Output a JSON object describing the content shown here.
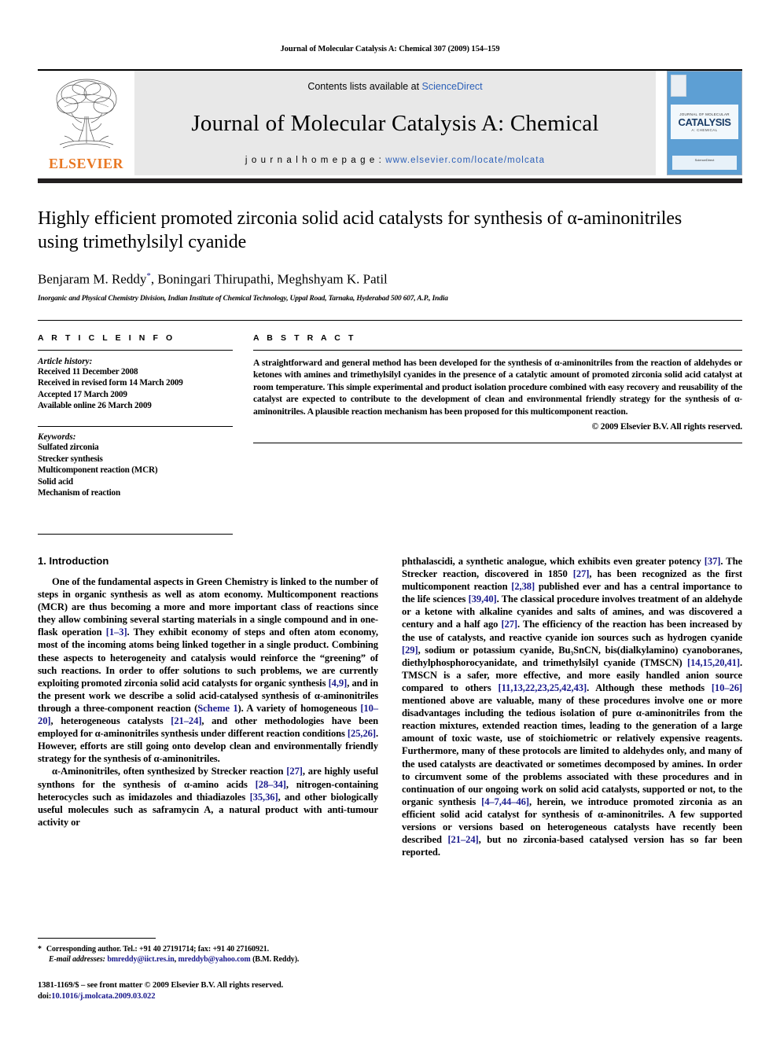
{
  "running_head": "Journal of Molecular Catalysis A: Chemical 307 (2009) 154–159",
  "masthead": {
    "publisher_name": "ELSEVIER",
    "contents_prefix": "Contents lists available at ",
    "contents_link": "ScienceDirect",
    "journal_title": "Journal of Molecular Catalysis A: Chemical",
    "homepage_label": "j o u r n a l   h o m e p a g e :  ",
    "homepage_url": "www.elsevier.com/locate/molcata",
    "cover": {
      "kicker": "JOURNAL OF MOLECULAR",
      "main": "CATALYSIS",
      "sub": "A: CHEMICAL",
      "footer": "ScienceDirect"
    }
  },
  "article": {
    "title": "Highly efficient promoted zirconia solid acid catalysts for synthesis of α-aminonitriles using trimethylsilyl cyanide",
    "authors": "Benjaram M. Reddy, Boningari Thirupathi, Meghshyam K. Patil",
    "corresponding_marker": "*",
    "authors_before_marker": "Benjaram M. Reddy",
    "authors_after_marker": ", Boningari Thirupathi, Meghshyam K. Patil",
    "affiliation": "Inorganic and Physical Chemistry Division, Indian Institute of Chemical Technology, Uppal Road, Tarnaka, Hyderabad 500 607, A.P., India"
  },
  "article_info": {
    "heading": "A R T I C L E   I N F O",
    "history_label": "Article history:",
    "history": [
      "Received 11 December 2008",
      "Received in revised form 14 March 2009",
      "Accepted 17 March 2009",
      "Available online 26 March 2009"
    ],
    "keywords_label": "Keywords:",
    "keywords": [
      "Sulfated zirconia",
      "Strecker synthesis",
      "Multicomponent reaction (MCR)",
      "Solid acid",
      "Mechanism of reaction"
    ]
  },
  "abstract": {
    "heading": "A B S T R A C T",
    "text": "A straightforward and general method has been developed for the synthesis of α-aminonitriles from the reaction of aldehydes or ketones with amines and trimethylsilyl cyanides in the presence of a catalytic amount of promoted zirconia solid acid catalyst at room temperature. This simple experimental and product isolation procedure combined with easy recovery and reusability of the catalyst are expected to contribute to the development of clean and environmental friendly strategy for the synthesis of α-aminonitriles. A plausible reaction mechanism has been proposed for this multicomponent reaction.",
    "copyright": "© 2009 Elsevier B.V. All rights reserved."
  },
  "introduction": {
    "section_number": "1.",
    "section_title": "Introduction",
    "left_paragraph_1": [
      {
        "t": "One of the fundamental aspects in Green Chemistry is linked to the number of steps in organic synthesis as well as atom economy. Multicomponent reactions (MCR) are thus becoming a more and more important class of reactions since they allow combining several starting materials in a single compound and in one-flask operation "
      },
      {
        "t": "[1–3]",
        "ref": true
      },
      {
        "t": ". They exhibit economy of steps and often atom economy, most of the incoming atoms being linked together in a single product. Combining these aspects to heterogeneity and catalysis would reinforce the “greening” of such reactions. In order to offer solutions to such problems, we are currently exploiting promoted zirconia solid acid catalysts for organic synthesis "
      },
      {
        "t": "[4,9]",
        "ref": true
      },
      {
        "t": ", and in the present work we describe a solid acid-catalysed synthesis of α-aminonitriles through a three-component reaction ("
      },
      {
        "t": "Scheme 1",
        "ref": true
      },
      {
        "t": "). A variety of homogeneous "
      },
      {
        "t": "[10–20]",
        "ref": true
      },
      {
        "t": ", heterogeneous catalysts "
      },
      {
        "t": "[21–24]",
        "ref": true
      },
      {
        "t": ", and other methodologies have been employed for α-aminonitriles synthesis under different reaction conditions "
      },
      {
        "t": "[25,26]",
        "ref": true
      },
      {
        "t": ". However, efforts are still going onto develop clean and environmentally friendly strategy for the synthesis of α-aminonitriles."
      }
    ],
    "left_paragraph_2": [
      {
        "t": "α-Aminonitriles, often synthesized by Strecker reaction "
      },
      {
        "t": "[27]",
        "ref": true
      },
      {
        "t": ", are highly useful synthons for the synthesis of α-amino acids "
      },
      {
        "t": "[28–34]",
        "ref": true
      },
      {
        "t": ", nitrogen-containing heterocycles such as imidazoles and thiadiazoles "
      },
      {
        "t": "[35,36]",
        "ref": true
      },
      {
        "t": ", and other biologically useful molecules such as saframycin A, a natural product with anti-tumour activity or"
      }
    ],
    "right_paragraph_1": [
      {
        "t": "phthalascidi, a synthetic analogue, which exhibits even greater potency "
      },
      {
        "t": "[37]",
        "ref": true
      },
      {
        "t": ". The Strecker reaction, discovered in 1850 "
      },
      {
        "t": "[27]",
        "ref": true
      },
      {
        "t": ", has been recognized as the first multicomponent reaction "
      },
      {
        "t": "[2,38]",
        "ref": true
      },
      {
        "t": " published ever and has a central importance to the life sciences "
      },
      {
        "t": "[39,40]",
        "ref": true
      },
      {
        "t": ". The classical procedure involves treatment of an aldehyde or a ketone with alkaline cyanides and salts of amines, and was discovered a century and a half ago "
      },
      {
        "t": "[27]",
        "ref": true
      },
      {
        "t": ". The efficiency of the reaction has been increased by the use of catalysts, and reactive cyanide ion sources such as hydrogen cyanide "
      },
      {
        "t": "[29]",
        "ref": true
      },
      {
        "t": ", sodium or potassium cyanide, Bu₃SnCN, bis(dialkylamino) cyanoboranes, diethylphosphorocyanidate, and trimethylsilyl cyanide (TMSCN) "
      },
      {
        "t": "[14,15,20,41]",
        "ref": true
      },
      {
        "t": ". TMSCN is a safer, more effective, and more easily handled anion source compared to others "
      },
      {
        "t": "[11,13,22,23,25,42,43]",
        "ref": true
      },
      {
        "t": ". Although these methods "
      },
      {
        "t": "[10–26]",
        "ref": true
      },
      {
        "t": " mentioned above are valuable, many of these procedures involve one or more disadvantages including the tedious isolation of pure α-aminonitriles from the reaction mixtures, extended reaction times, leading to the generation of a large amount of toxic waste, use of stoichiometric or relatively expensive reagents. Furthermore, many of these protocols are limited to aldehydes only, and many of the used catalysts are deactivated or sometimes decomposed by amines. In order to circumvent some of the problems associated with these procedures and in continuation of our ongoing work on solid acid catalysts, supported or not, to the organic synthesis "
      },
      {
        "t": "[4–7,44–46]",
        "ref": true
      },
      {
        "t": ", herein, we introduce promoted zirconia as an efficient solid acid catalyst for synthesis of α-aminonitriles. A few supported versions or versions based on heterogeneous catalysts have recently been described "
      },
      {
        "t": "[21–24]",
        "ref": true
      },
      {
        "t": ", but no zirconia-based catalysed version has so far been reported."
      }
    ]
  },
  "footnotes": {
    "corresponding_marker": "*",
    "corresponding_text": "Corresponding author. Tel.: +91 40 27191714; fax: +91 40 27160921.",
    "email_label": "E-mail addresses:",
    "email_1": "bmreddy@iict.res.in",
    "email_sep": ", ",
    "email_2": "mreddyb@yahoo.com",
    "email_attrib": " (B.M. Reddy)."
  },
  "imprint": {
    "issn_line": "1381-1169/$ – see front matter © 2009 Elsevier B.V. All rights reserved.",
    "doi_label": "doi:",
    "doi_value": "10.1016/j.molcata.2009.03.022"
  },
  "colors": {
    "link_blue": "#1a1a8c",
    "sciencedirect_blue": "#2b5fb8",
    "elsevier_orange": "#E87722",
    "masthead_gray": "#e8e8e8"
  }
}
